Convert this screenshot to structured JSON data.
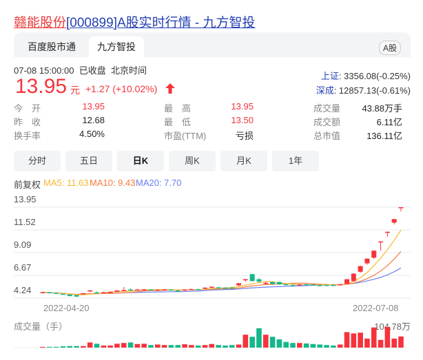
{
  "title": {
    "name": "赣能股份",
    "rest": "[000899]A股实时行情 - 九方智投"
  },
  "tabs": [
    "百度股市通",
    "九方智投"
  ],
  "badge": "A股",
  "status": {
    "time": "07-08 15:00:00",
    "state": "已收盘",
    "tz": "北京时间"
  },
  "quote": {
    "price": "13.95",
    "unit": "元",
    "change": "+1.27 (+10.02%)"
  },
  "indices": [
    {
      "name": "上证",
      "value": ": 3356.08(-0.25%)"
    },
    {
      "name": "深成",
      "value": ": 12857.13(-0.61%)"
    }
  ],
  "stats": [
    [
      {
        "label": "今　开",
        "value": "13.95",
        "red": true
      },
      {
        "label": "最　高",
        "value": "13.95",
        "red": true
      },
      {
        "label": "成交量",
        "value": "43.88万手"
      }
    ],
    [
      {
        "label": "昨　收",
        "value": "12.68"
      },
      {
        "label": "最　低",
        "value": "13.50",
        "red": true
      },
      {
        "label": "成交额",
        "value": "6.11亿"
      }
    ],
    [
      {
        "label": "换手率",
        "value": "4.50%"
      },
      {
        "label": "市盈(TTM)",
        "value": "亏损"
      },
      {
        "label": "总市值",
        "value": "136.11亿"
      }
    ]
  ],
  "period_buttons": [
    "分时",
    "五日",
    "日K",
    "周K",
    "月K",
    "1年"
  ],
  "ma_legend": {
    "adjust": "前复权",
    "ma5": "MA5: 11.63",
    "ma10": "MA10: 9.43",
    "ma20": "MA20: 7.70"
  },
  "colors": {
    "up": "#f5333c",
    "down": "#14b88a",
    "ma5": "#f7b731",
    "ma10": "#f47c3c",
    "ma20": "#6a7ef0"
  },
  "chart_data": {
    "type": "candlestick",
    "y_ticks": [
      "13.95",
      "11.52",
      "9.09",
      "6.67",
      "4.24"
    ],
    "ylim": [
      4.24,
      13.95
    ],
    "x_labels": [
      "2022-04-20",
      "2022-07-08"
    ],
    "volume_label": "成交量（手）",
    "volume_max_label": "104.78万",
    "candles_ohlcv_wan": [
      [
        4.85,
        4.86,
        4.9,
        4.8,
        3
      ],
      [
        4.86,
        4.8,
        4.88,
        4.76,
        3
      ],
      [
        4.8,
        4.7,
        4.82,
        4.66,
        3
      ],
      [
        4.7,
        4.62,
        4.72,
        4.58,
        5
      ],
      [
        4.62,
        4.45,
        4.64,
        4.42,
        6
      ],
      [
        4.55,
        4.4,
        4.58,
        4.35,
        6
      ],
      [
        4.75,
        4.76,
        4.8,
        4.72,
        6
      ],
      [
        4.95,
        5.05,
        5.12,
        4.9,
        20
      ],
      [
        4.85,
        4.84,
        4.95,
        4.8,
        15
      ],
      [
        4.85,
        4.86,
        4.92,
        4.8,
        8
      ],
      [
        4.86,
        4.9,
        4.95,
        4.84,
        8
      ],
      [
        4.9,
        5.05,
        5.08,
        4.88,
        15
      ],
      [
        5.08,
        5.1,
        5.42,
        5.05,
        18
      ],
      [
        5.15,
        5.14,
        5.3,
        5.08,
        20
      ],
      [
        5.12,
        5.15,
        5.22,
        5.08,
        14
      ],
      [
        5.15,
        5.16,
        5.22,
        5.1,
        15
      ],
      [
        5.16,
        5.1,
        5.18,
        5.06,
        10
      ],
      [
        5.12,
        5.13,
        5.18,
        5.08,
        12
      ],
      [
        5.14,
        5.16,
        5.2,
        5.1,
        10
      ],
      [
        5.15,
        5.12,
        5.18,
        5.08,
        10
      ],
      [
        5.05,
        4.98,
        5.08,
        4.95,
        10
      ],
      [
        5.05,
        5.15,
        5.18,
        5.02,
        13
      ],
      [
        5.15,
        5.2,
        5.25,
        5.1,
        10
      ],
      [
        5.2,
        5.19,
        5.24,
        5.14,
        8
      ],
      [
        5.25,
        5.35,
        5.38,
        5.2,
        10
      ],
      [
        5.42,
        5.45,
        5.5,
        5.38,
        14
      ],
      [
        5.38,
        5.36,
        5.42,
        5.32,
        10
      ],
      [
        5.35,
        5.34,
        5.38,
        5.3,
        8
      ],
      [
        5.36,
        5.35,
        5.4,
        5.32,
        10
      ],
      [
        5.6,
        5.82,
        5.86,
        5.5,
        12
      ],
      [
        6.2,
        6.25,
        6.28,
        5.98,
        50
      ],
      [
        6.8,
        6.05,
        6.82,
        6.0,
        42
      ],
      [
        6.25,
        6.0,
        6.4,
        5.85,
        75
      ],
      [
        5.85,
        5.86,
        6.0,
        5.7,
        50
      ],
      [
        5.95,
        5.75,
        6.0,
        5.65,
        42
      ],
      [
        5.95,
        5.7,
        5.98,
        5.65,
        32
      ],
      [
        5.72,
        5.66,
        5.75,
        5.62,
        22
      ],
      [
        5.62,
        5.58,
        5.66,
        5.55,
        18
      ],
      [
        5.68,
        5.7,
        5.74,
        5.62,
        18
      ],
      [
        5.72,
        5.71,
        5.76,
        5.66,
        16
      ],
      [
        5.7,
        5.66,
        5.74,
        5.62,
        14
      ],
      [
        5.62,
        5.6,
        5.66,
        5.52,
        12
      ],
      [
        5.64,
        5.62,
        5.68,
        5.58,
        10
      ],
      [
        5.64,
        5.63,
        5.68,
        5.58,
        8
      ],
      [
        5.62,
        5.7,
        5.74,
        5.6,
        12
      ],
      [
        5.75,
        6.25,
        6.28,
        5.72,
        60
      ],
      [
        6.05,
        6.85,
        6.9,
        6.0,
        55
      ],
      [
        7.05,
        7.65,
        7.7,
        6.95,
        58
      ],
      [
        7.95,
        8.45,
        8.48,
        7.8,
        35
      ],
      [
        8.55,
        9.3,
        9.35,
        8.4,
        78
      ],
      [
        10.28,
        10.29,
        10.3,
        9.3,
        30
      ],
      [
        11.3,
        11.32,
        11.35,
        10.8,
        80
      ],
      [
        12.3,
        12.68,
        12.7,
        12.1,
        35
      ],
      [
        13.95,
        13.95,
        13.95,
        13.5,
        43
      ]
    ]
  }
}
